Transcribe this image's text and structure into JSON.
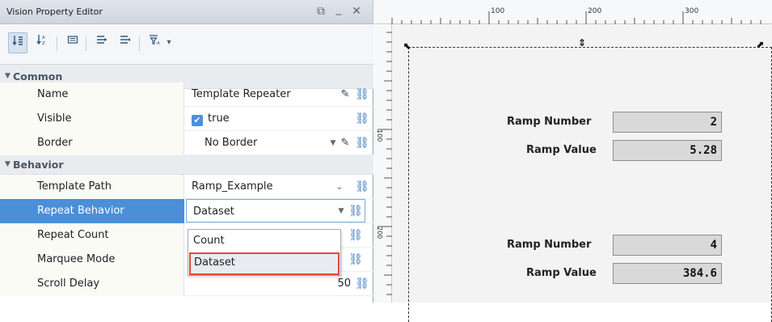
{
  "editor": {
    "title": "Vision Property Editor",
    "window_buttons": {
      "float": "⧉",
      "minimize": "_",
      "close": "✕"
    },
    "toolbar": {
      "icons": [
        "sort-categorized-icon",
        "sort-alphabetical-icon",
        "property-pages-icon",
        "expand-all-icon",
        "collapse-all-icon",
        "filter-icon"
      ],
      "filter_caret": "▾"
    },
    "categories": [
      {
        "label": "Common"
      },
      {
        "label": "Behavior"
      }
    ],
    "rows": {
      "name": {
        "label": "Name",
        "value": "Template Repeater"
      },
      "visible": {
        "label": "Visible",
        "value": "true"
      },
      "border": {
        "label": "Border",
        "value": "No Border"
      },
      "template_path": {
        "label": "Template Path",
        "value": "Ramp_Example"
      },
      "repeat_behavior": {
        "label": "Repeat Behavior",
        "value": "Dataset"
      },
      "repeat_count": {
        "label": "Repeat Count",
        "value": ""
      },
      "marquee_mode": {
        "label": "Marquee Mode",
        "value": ""
      },
      "scroll_delay": {
        "label": "Scroll Delay",
        "value": "50"
      }
    },
    "dropdown_options": [
      "Count",
      "Dataset"
    ],
    "dropdown_selected": "Dataset"
  },
  "canvas": {
    "ruler_top_labels": [
      "100",
      "200",
      "300"
    ],
    "ruler_left_labels": [
      "100",
      "200"
    ],
    "instances": [
      {
        "number_label": "Ramp Number",
        "number_value": "2",
        "value_label": "Ramp Value",
        "value": "5.28"
      },
      {
        "number_label": "Ramp Number",
        "number_value": "4",
        "value_label": "Ramp Value",
        "value": "384.6"
      }
    ]
  },
  "colors": {
    "selection": "#4a8fd8",
    "highlight_outline": "#e0473f",
    "bind_icon": "#2f72b8"
  }
}
